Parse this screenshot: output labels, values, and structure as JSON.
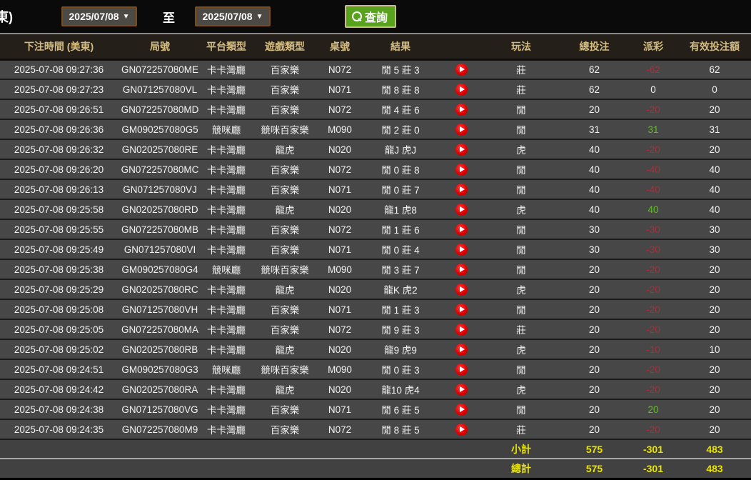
{
  "toolbar": {
    "partial_label": "東)",
    "date_from": "2025/07/08",
    "to_label": "至",
    "date_to": "2025/07/08",
    "caret": "▼",
    "search_button_label": "查詢"
  },
  "table": {
    "headers": {
      "time": "下注時間 (美東)",
      "game_id": "局號",
      "platform": "平台類型",
      "game_type": "遊戲類型",
      "table_no": "桌號",
      "result": "結果",
      "icon_col": "",
      "play": "玩法",
      "total_bet": "總投注",
      "payout": "派彩",
      "valid_bet": "有效投注額"
    },
    "rows": [
      {
        "time": "2025-07-08 09:27:36",
        "id": "GN072257080ME",
        "platform": "卡卡灣廳",
        "game": "百家樂",
        "table_no": "N072",
        "result": "閒 5 莊 3",
        "play": "莊",
        "bet": "62",
        "payout": "-62",
        "valid": "62"
      },
      {
        "time": "2025-07-08 09:27:23",
        "id": "GN071257080VL",
        "platform": "卡卡灣廳",
        "game": "百家樂",
        "table_no": "N071",
        "result": "閒 8 莊 8",
        "play": "莊",
        "bet": "62",
        "payout": "0",
        "valid": "0"
      },
      {
        "time": "2025-07-08 09:26:51",
        "id": "GN072257080MD",
        "platform": "卡卡灣廳",
        "game": "百家樂",
        "table_no": "N072",
        "result": "閒 4 莊 6",
        "play": "閒",
        "bet": "20",
        "payout": "-20",
        "valid": "20"
      },
      {
        "time": "2025-07-08 09:26:36",
        "id": "GM090257080G5",
        "platform": "競咪廳",
        "game": "競咪百家樂",
        "table_no": "M090",
        "result": "閒 2 莊 0",
        "play": "閒",
        "bet": "31",
        "payout": "31",
        "valid": "31"
      },
      {
        "time": "2025-07-08 09:26:32",
        "id": "GN020257080RE",
        "platform": "卡卡灣廳",
        "game": "龍虎",
        "table_no": "N020",
        "result": "龍J 虎J",
        "play": "虎",
        "bet": "40",
        "payout": "-20",
        "valid": "20"
      },
      {
        "time": "2025-07-08 09:26:20",
        "id": "GN072257080MC",
        "platform": "卡卡灣廳",
        "game": "百家樂",
        "table_no": "N072",
        "result": "閒 0 莊 8",
        "play": "閒",
        "bet": "40",
        "payout": "-40",
        "valid": "40"
      },
      {
        "time": "2025-07-08 09:26:13",
        "id": "GN071257080VJ",
        "platform": "卡卡灣廳",
        "game": "百家樂",
        "table_no": "N071",
        "result": "閒 0 莊 7",
        "play": "閒",
        "bet": "40",
        "payout": "-40",
        "valid": "40"
      },
      {
        "time": "2025-07-08 09:25:58",
        "id": "GN020257080RD",
        "platform": "卡卡灣廳",
        "game": "龍虎",
        "table_no": "N020",
        "result": "龍1 虎8",
        "play": "虎",
        "bet": "40",
        "payout": "40",
        "valid": "40"
      },
      {
        "time": "2025-07-08 09:25:55",
        "id": "GN072257080MB",
        "platform": "卡卡灣廳",
        "game": "百家樂",
        "table_no": "N072",
        "result": "閒 1 莊 6",
        "play": "閒",
        "bet": "30",
        "payout": "-30",
        "valid": "30"
      },
      {
        "time": "2025-07-08 09:25:49",
        "id": "GN071257080VI",
        "platform": "卡卡灣廳",
        "game": "百家樂",
        "table_no": "N071",
        "result": "閒 0 莊 4",
        "play": "閒",
        "bet": "30",
        "payout": "-30",
        "valid": "30"
      },
      {
        "time": "2025-07-08 09:25:38",
        "id": "GM090257080G4",
        "platform": "競咪廳",
        "game": "競咪百家樂",
        "table_no": "M090",
        "result": "閒 3 莊 7",
        "play": "閒",
        "bet": "20",
        "payout": "-20",
        "valid": "20"
      },
      {
        "time": "2025-07-08 09:25:29",
        "id": "GN020257080RC",
        "platform": "卡卡灣廳",
        "game": "龍虎",
        "table_no": "N020",
        "result": "龍K 虎2",
        "play": "虎",
        "bet": "20",
        "payout": "-20",
        "valid": "20"
      },
      {
        "time": "2025-07-08 09:25:08",
        "id": "GN071257080VH",
        "platform": "卡卡灣廳",
        "game": "百家樂",
        "table_no": "N071",
        "result": "閒 1 莊 3",
        "play": "閒",
        "bet": "20",
        "payout": "-20",
        "valid": "20"
      },
      {
        "time": "2025-07-08 09:25:05",
        "id": "GN072257080MA",
        "platform": "卡卡灣廳",
        "game": "百家樂",
        "table_no": "N072",
        "result": "閒 9 莊 3",
        "play": "莊",
        "bet": "20",
        "payout": "-20",
        "valid": "20"
      },
      {
        "time": "2025-07-08 09:25:02",
        "id": "GN020257080RB",
        "platform": "卡卡灣廳",
        "game": "龍虎",
        "table_no": "N020",
        "result": "龍9 虎9",
        "play": "虎",
        "bet": "20",
        "payout": "-10",
        "valid": "10"
      },
      {
        "time": "2025-07-08 09:24:51",
        "id": "GM090257080G3",
        "platform": "競咪廳",
        "game": "競咪百家樂",
        "table_no": "M090",
        "result": "閒 0 莊 3",
        "play": "閒",
        "bet": "20",
        "payout": "-20",
        "valid": "20"
      },
      {
        "time": "2025-07-08 09:24:42",
        "id": "GN020257080RA",
        "platform": "卡卡灣廳",
        "game": "龍虎",
        "table_no": "N020",
        "result": "龍10 虎4",
        "play": "虎",
        "bet": "20",
        "payout": "-20",
        "valid": "20"
      },
      {
        "time": "2025-07-08 09:24:38",
        "id": "GN071257080VG",
        "platform": "卡卡灣廳",
        "game": "百家樂",
        "table_no": "N071",
        "result": "閒 6 莊 5",
        "play": "閒",
        "bet": "20",
        "payout": "20",
        "valid": "20"
      },
      {
        "time": "2025-07-08 09:24:35",
        "id": "GN072257080M9",
        "platform": "卡卡灣廳",
        "game": "百家樂",
        "table_no": "N072",
        "result": "閒 8 莊 5",
        "play": "莊",
        "bet": "20",
        "payout": "-20",
        "valid": "20"
      }
    ],
    "subtotal": {
      "label": "小計",
      "bet": "575",
      "payout": "-301",
      "valid": "483"
    },
    "total": {
      "label": "總計",
      "bet": "575",
      "payout": "-301",
      "valid": "483"
    }
  },
  "colors": {
    "payout_negative": "#ab2e3a",
    "payout_positive": "#5bc417",
    "totals_yellow": "#e9e400",
    "header_text": "#d3bb82",
    "search_button_green": "#58a21e",
    "date_border_brown": "#7c4c18",
    "play_icon_red": "#e00000"
  }
}
